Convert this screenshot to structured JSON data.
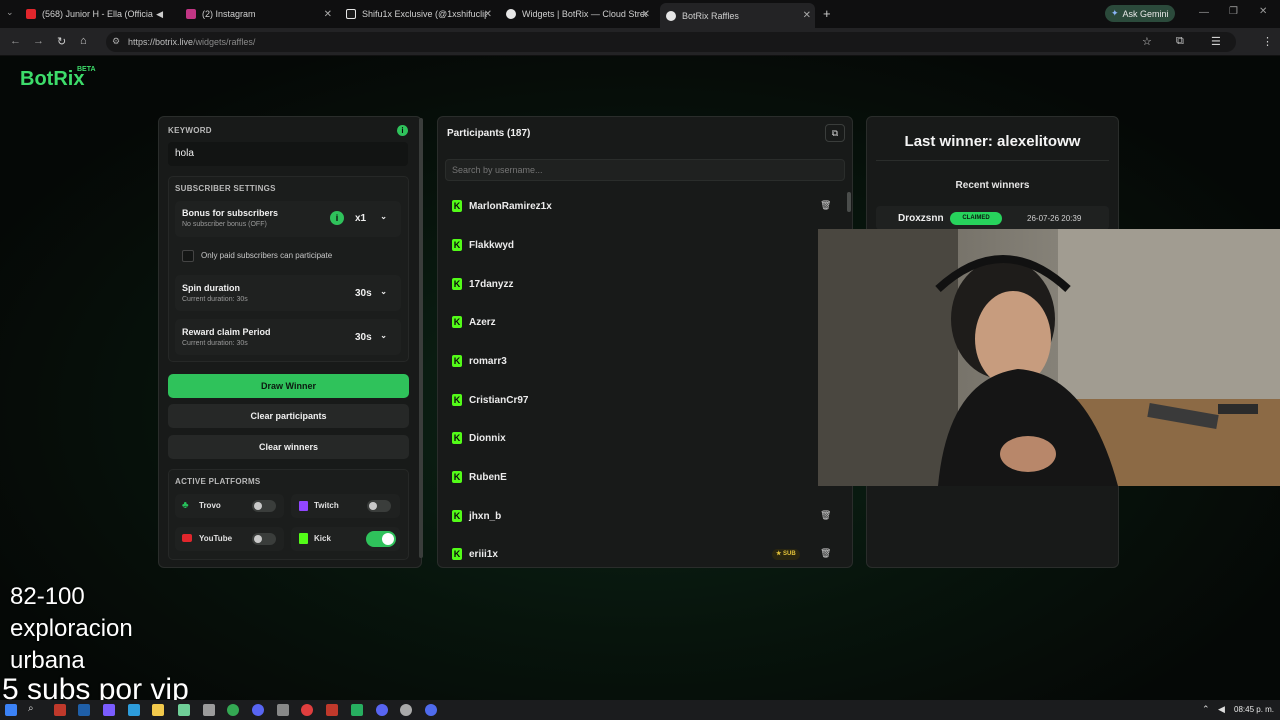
{
  "browser": {
    "tabs": [
      {
        "label": "(568) Junior H - Ella (Officia",
        "favicon_color": "#e1262c"
      },
      {
        "label": "(2) Instagram",
        "favicon_color": "#c13584"
      },
      {
        "label": "Shifu1x Exclusive (@1xshifuclip",
        "favicon_color": "#e6e6e6"
      },
      {
        "label": "Widgets | BotRix — Cloud Strea",
        "favicon_color": "#e6e6e6"
      },
      {
        "label": "BotRix Raffles",
        "favicon_color": "#e6e6e6"
      }
    ],
    "ask_gemini": "Ask Gemini",
    "url_host": "https://botrix.live",
    "url_path": "/widgets/raffles/",
    "profile_initial": "J"
  },
  "app": {
    "logo": "BotRix",
    "beta": "BETA"
  },
  "settings": {
    "keyword_label": "KEYWORD",
    "keyword_value": "hola",
    "subscriber_settings_label": "SUBSCRIBER SETTINGS",
    "bonus_title": "Bonus for subscribers",
    "bonus_sub": "No subscriber bonus (OFF)",
    "bonus_value": "x1",
    "only_paid_label": "Only paid subscribers can participate",
    "spin_title": "Spin duration",
    "spin_sub": "Current duration: 30s",
    "spin_value": "30s",
    "reward_title": "Reward claim Period",
    "reward_sub": "Current duration: 30s",
    "reward_value": "30s",
    "draw_winner": "Draw Winner",
    "clear_participants": "Clear participants",
    "clear_winners": "Clear winners",
    "active_platforms_label": "ACTIVE PLATFORMS",
    "platforms": [
      {
        "name": "Trovo",
        "enabled": false
      },
      {
        "name": "Twitch",
        "enabled": false
      },
      {
        "name": "YouTube",
        "enabled": false
      },
      {
        "name": "Kick",
        "enabled": true
      }
    ]
  },
  "participants": {
    "title": "Participants (187)",
    "search_placeholder": "Search by username...",
    "list": [
      {
        "name": "MarlonRamirez1x"
      },
      {
        "name": "Flakkwyd"
      },
      {
        "name": "17danyzz"
      },
      {
        "name": "Azerz"
      },
      {
        "name": "romarr3"
      },
      {
        "name": "CristianCr97"
      },
      {
        "name": "Dionnix"
      },
      {
        "name": "RubenE"
      },
      {
        "name": "jhxn_b"
      },
      {
        "name": "eriii1x",
        "badge": "SUB"
      }
    ]
  },
  "winners": {
    "last_winner": "Last winner: alexelitoww",
    "recent_label": "Recent winners",
    "recent": [
      {
        "name": "Droxzsnn",
        "status": "CLAIMED",
        "time": "26-07-26 20:39"
      }
    ]
  },
  "overlay": {
    "line1": "82-100",
    "line2": "exploracion",
    "line3": "urbana",
    "line4": "5 subs por vip"
  },
  "taskbar": {
    "clock": "08:45 p. m."
  },
  "colors": {
    "accent_green": "#2fc25b",
    "kick_green": "#53fc18",
    "claimed_green": "#27d35c"
  }
}
